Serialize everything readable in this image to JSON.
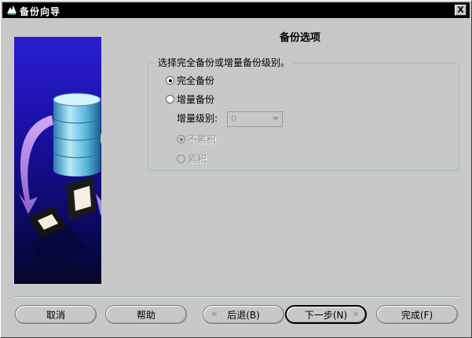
{
  "window": {
    "title": "备份向导",
    "close_symbol": "X"
  },
  "page": {
    "heading": "备份选项"
  },
  "backup_options": {
    "legend": "选择完全备份或增量备份级别。",
    "full_backup": {
      "label": "完全备份",
      "selected": true
    },
    "incremental_backup": {
      "label": "增量备份",
      "selected": false
    },
    "level_label": "增量级别:",
    "level_value": "0",
    "non_cumulative": {
      "label": "不累积",
      "selected": true,
      "enabled": false
    },
    "cumulative": {
      "label": "累积",
      "selected": false,
      "enabled": false
    }
  },
  "buttons": {
    "cancel": "取消",
    "help": "帮助",
    "back": "后退(B)",
    "next": "下一步(N)",
    "finish": "完成(F)"
  },
  "colors": {
    "background": "#c8c8c8",
    "titlebar": "#000000",
    "illustration_blue": "#1a12a8",
    "group_border": "#9fbdbd"
  }
}
